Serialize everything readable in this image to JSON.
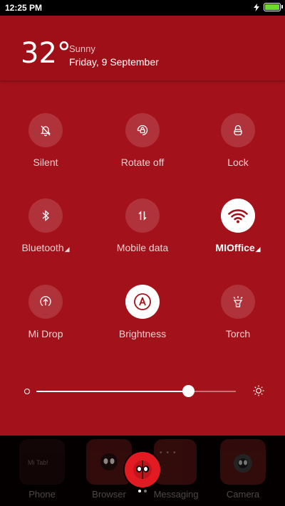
{
  "status_bar": {
    "time": "12:25 PM",
    "icons": [
      "charging-icon",
      "battery-icon"
    ],
    "battery_color": "#6cdc30"
  },
  "weather": {
    "temperature": "32°",
    "condition": "Sunny",
    "date": "Friday, 9 September"
  },
  "toggles": [
    {
      "label": "Silent",
      "icon": "bell-off-icon",
      "on": false
    },
    {
      "label": "Rotate off",
      "icon": "rotate-lock-icon",
      "on": false
    },
    {
      "label": "Lock",
      "icon": "lock-icon",
      "on": false
    },
    {
      "label": "Bluetooth",
      "icon": "bluetooth-icon",
      "on": false,
      "expandable": true
    },
    {
      "label": "Mobile data",
      "icon": "mobile-data-icon",
      "on": false
    },
    {
      "label": "MIOffice",
      "icon": "wifi-icon",
      "on": true,
      "expandable": true
    },
    {
      "label": "Mi Drop",
      "icon": "mi-drop-icon",
      "on": false
    },
    {
      "label": "Brightness",
      "icon": "auto-brightness-icon",
      "on": true
    },
    {
      "label": "Torch",
      "icon": "torch-icon",
      "on": false
    }
  ],
  "brightness": {
    "level": 0.76,
    "icons": [
      "brightness-low-icon",
      "brightness-high-icon"
    ]
  },
  "dock": {
    "apps": [
      {
        "label": "Phone"
      },
      {
        "label": "Browser"
      },
      {
        "label": "Messaging"
      },
      {
        "label": "Camera"
      }
    ],
    "tile_preview_text": "Mi Tab!",
    "page_indicator": {
      "count": 2,
      "active": 0
    }
  },
  "colors": {
    "background": "#a3111a",
    "accent_toggle_on": "#ffffff",
    "fab": "#e21b23"
  }
}
